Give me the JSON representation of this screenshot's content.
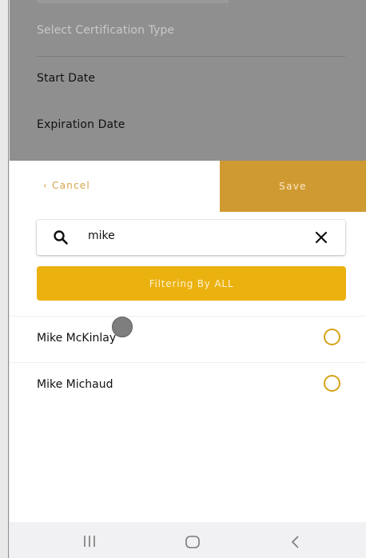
{
  "form": {
    "certification_type_placeholder": "Select Certification Type",
    "start_date_label": "Start Date",
    "expiration_date_label": "Expiration Date"
  },
  "sheet": {
    "cancel_label": "‹ Cancel",
    "save_label": "Save",
    "search": {
      "value": "mike",
      "icon": "search-icon",
      "clear_icon": "close-icon"
    },
    "filter_label": "Filtering By ALL",
    "results": [
      {
        "name": "Mike McKinlay",
        "selected": false
      },
      {
        "name": "Mike Michaud",
        "selected": false
      }
    ]
  },
  "navbar": {
    "recents_icon": "recents-icon",
    "home_icon": "home-icon",
    "back_icon": "back-icon"
  },
  "colors": {
    "accent": "#d09a32",
    "filter_button": "#eab10f",
    "radio": "#d6a21a",
    "overlay": "#8f8f8f"
  }
}
